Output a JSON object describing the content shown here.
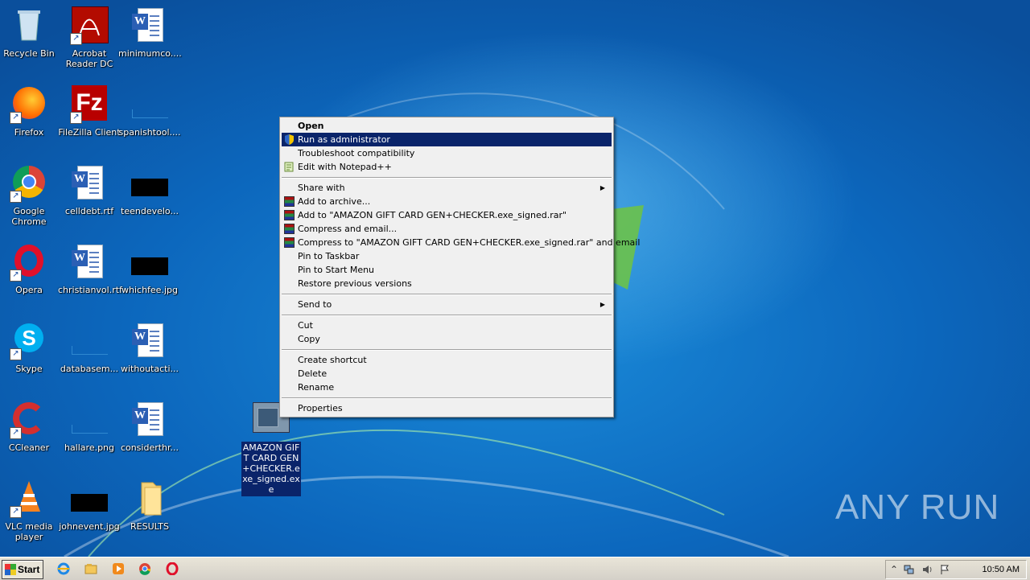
{
  "desktop": {
    "icons": [
      {
        "label": "Recycle Bin"
      },
      {
        "label": "Acrobat Reader DC"
      },
      {
        "label": "minimumco...."
      },
      {
        "label": "Firefox"
      },
      {
        "label": "FileZilla Client"
      },
      {
        "label": "spanishtool...."
      },
      {
        "label": "Google Chrome"
      },
      {
        "label": "celldebt.rtf"
      },
      {
        "label": "teendevelo..."
      },
      {
        "label": "Opera"
      },
      {
        "label": "christianvol.rtf"
      },
      {
        "label": "whichfee.jpg"
      },
      {
        "label": "Skype"
      },
      {
        "label": "databasem..."
      },
      {
        "label": "withoutacti..."
      },
      {
        "label": "CCleaner"
      },
      {
        "label": "hallare.png"
      },
      {
        "label": "considerthr..."
      },
      {
        "label": "VLC media player"
      },
      {
        "label": "johnevent.jpg"
      },
      {
        "label": "RESULTS"
      }
    ],
    "selected_file": {
      "label": "AMAZON GIFT CARD GEN+CHECKER.exe_signed.exe"
    }
  },
  "context_menu": {
    "items": [
      {
        "label": "Open",
        "icon": ""
      },
      {
        "label": "Run as administrator",
        "icon": "uac-shield-icon"
      },
      {
        "label": "Troubleshoot compatibility",
        "icon": ""
      },
      {
        "label": "Edit with Notepad++",
        "icon": "notepadpp-icon"
      },
      {
        "label": "Share with",
        "icon": ""
      },
      {
        "label": "Add to archive...",
        "icon": "winrar-icon"
      },
      {
        "label": "Add to \"AMAZON GIFT CARD GEN+CHECKER.exe_signed.rar\"",
        "icon": "winrar-icon"
      },
      {
        "label": "Compress and email...",
        "icon": "winrar-icon"
      },
      {
        "label": "Compress to \"AMAZON GIFT CARD GEN+CHECKER.exe_signed.rar\" and email",
        "icon": "winrar-icon"
      },
      {
        "label": "Pin to Taskbar",
        "icon": ""
      },
      {
        "label": "Pin to Start Menu",
        "icon": ""
      },
      {
        "label": "Restore previous versions",
        "icon": ""
      },
      {
        "label": "Send to",
        "icon": ""
      },
      {
        "label": "Cut",
        "icon": ""
      },
      {
        "label": "Copy",
        "icon": ""
      },
      {
        "label": "Create shortcut",
        "icon": ""
      },
      {
        "label": "Delete",
        "icon": ""
      },
      {
        "label": "Rename",
        "icon": ""
      },
      {
        "label": "Properties",
        "icon": ""
      }
    ],
    "highlighted": "Run as administrator"
  },
  "taskbar": {
    "start_label": "Start",
    "clock": "10:50 AM",
    "quick_launch": [
      "internet-explorer-icon",
      "explorer-folder-icon",
      "media-player-icon",
      "chrome-icon",
      "opera-icon"
    ],
    "tray_icons": [
      "show-hidden-icons-chevron",
      "network-icon",
      "volume-icon",
      "action-center-flag-icon"
    ]
  },
  "watermark": {
    "text": "ANY RUN"
  },
  "colors": {
    "menu_highlight": "#0a246a",
    "desktop_blue": "#0d63b8"
  }
}
